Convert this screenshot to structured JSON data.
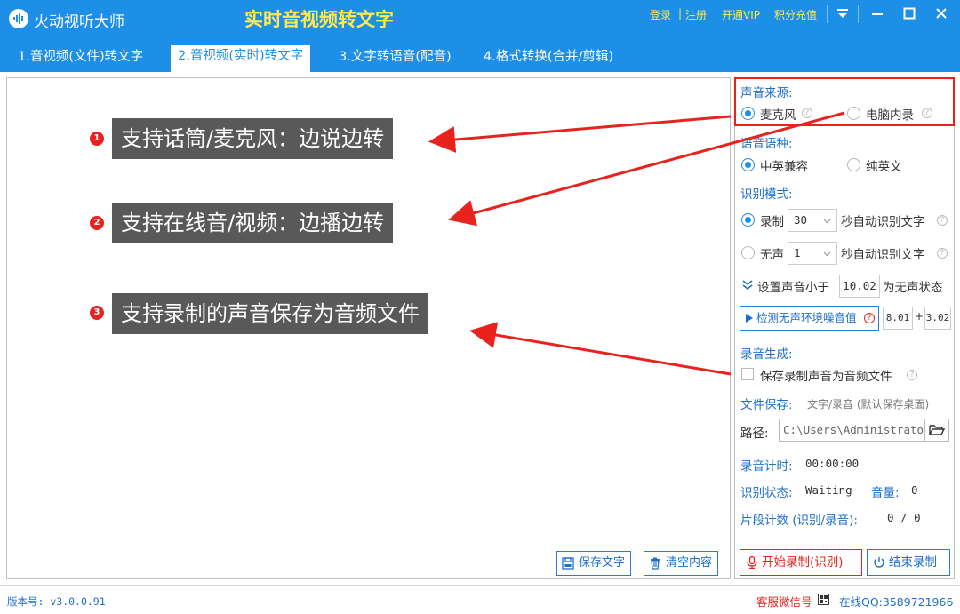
{
  "app": {
    "name": "火动视听大师",
    "main_title": "实时音视频转文字",
    "login": "登录",
    "separator": "|",
    "register": "注册",
    "vip": "开通VIP",
    "recharge": "积分充值"
  },
  "tabs": [
    {
      "label": "1.音视频(文件)转文字"
    },
    {
      "label": "2.音视频(实时)转文字"
    },
    {
      "label": "3.文字转语音(配音)"
    },
    {
      "label": "4.格式转换(合并/剪辑)"
    }
  ],
  "callouts": [
    {
      "badge": "1",
      "text": "支持话筒/麦克风：边说边转"
    },
    {
      "badge": "2",
      "text": "支持在线音/视频：边播边转"
    },
    {
      "badge": "3",
      "text": "支持录制的声音保存为音频文件"
    }
  ],
  "content_buttons": {
    "save_text": "保存文字",
    "clear": "清空内容"
  },
  "panel": {
    "source_label": "声音来源:",
    "source_mic": "麦克风",
    "source_pc": "电脑内录",
    "lang_label": "语音语种:",
    "lang_mixed": "中英兼容",
    "lang_english": "纯英文",
    "mode_label": "识别模式:",
    "mode_record": "录制",
    "mode_record_value": "30",
    "mode_record_suffix": "秒自动识别文字",
    "mode_silent": "无声",
    "mode_silent_value": "1",
    "mode_silent_suffix": "秒自动识别文字",
    "threshold_prefix": "设置声音小于",
    "threshold_value": "10.02",
    "threshold_suffix": "为无声状态",
    "detect_button": "检测无声环境噪音值",
    "noise_value": "8.01",
    "plus": "+",
    "noise_offset": "3.02",
    "gen_label": "录音生成:",
    "save_audio": "保存录制声音为音频文件",
    "file_save_label": "文件保存:",
    "file_save_hint": "文字/录音 (默认保存桌面)",
    "path_label": "路径:",
    "path_value": "C:\\Users\\Administrator",
    "timer_label": "录音计时:",
    "timer_value": "00:00:00",
    "state_label": "识别状态:",
    "state_value": "Waiting",
    "volume_label": "音量:",
    "volume_value": "0",
    "segments_label": "片段计数 (识别/录音):",
    "segments_value": "0 / 0",
    "start_button": "开始录制(识别)",
    "stop_button": "结束录制"
  },
  "status": {
    "version": "版本号: v3.0.0.91",
    "wechat": "客服微信号",
    "qq": "在线QQ:3589721966"
  },
  "colors": {
    "brand_blue": "#1e8fe6",
    "title_yellow": "#ffe94d",
    "accent_red": "#e8231e",
    "callout_bg": "#595959"
  }
}
